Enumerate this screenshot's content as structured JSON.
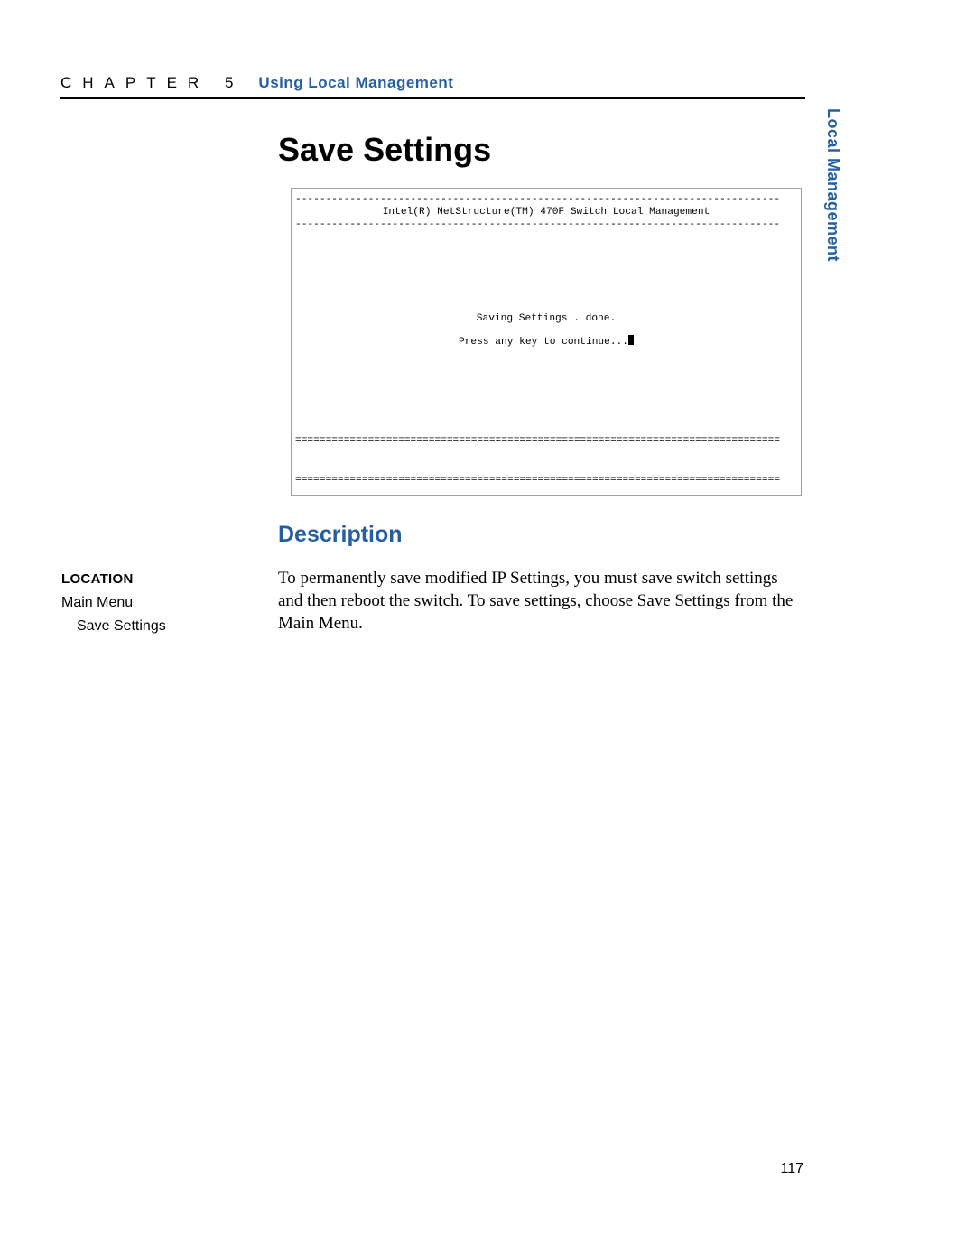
{
  "header": {
    "chapter": "CHAPTER 5",
    "title": "Using Local Management"
  },
  "sidetab": "Local Management",
  "h1": "Save Settings",
  "terminal": {
    "dash_row": "--------------------------------------------------------------------------------",
    "title": "Intel(R) NetStructure(TM) 470F Switch Local Management",
    "line1": "Saving Settings .  done.",
    "line2": "Press any key to continue...",
    "eq_row": "================================================================================"
  },
  "h2": "Description",
  "body": "To permanently save modified IP Settings, you must save switch settings and then reboot the switch. To save settings, choose Save Settings from the Main Menu.",
  "location": {
    "heading": "LOCATION",
    "l1": "Main Menu",
    "l2": "Save Settings"
  },
  "page_number": "117"
}
